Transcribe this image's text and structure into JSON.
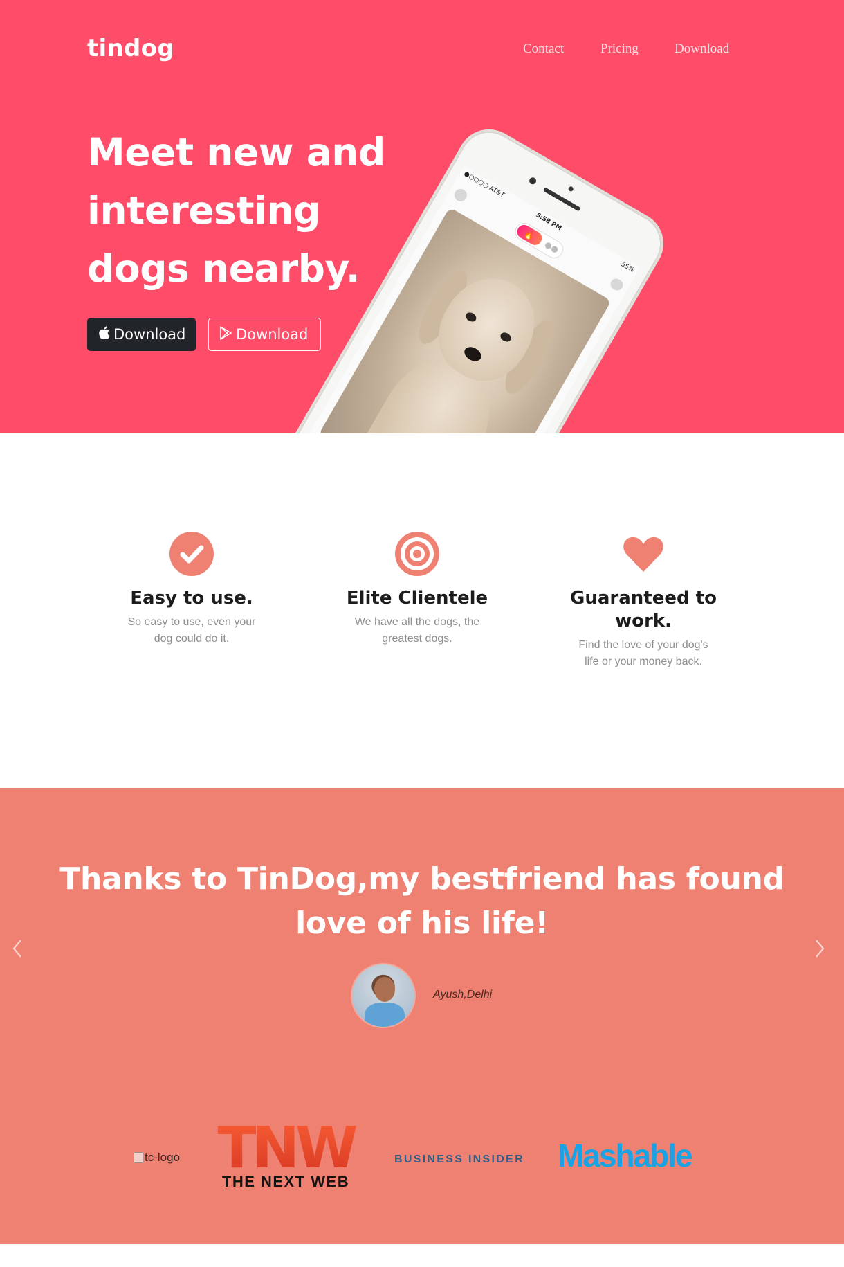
{
  "header": {
    "brand": "tindog",
    "nav": [
      {
        "label": "Contact"
      },
      {
        "label": "Pricing"
      },
      {
        "label": "Download"
      }
    ]
  },
  "hero": {
    "title": "Meet new and interesting dogs nearby.",
    "buttons": [
      {
        "label": "Download",
        "icon": "apple-icon"
      },
      {
        "label": "Download",
        "icon": "google-play-icon"
      }
    ],
    "phone": {
      "carrier": "●○○○○ AT&T",
      "time": "5:58 PM",
      "battery": "55%"
    }
  },
  "features": [
    {
      "icon": "check-circle-icon",
      "title": "Easy to use.",
      "description": "So easy to use, even your dog could do it."
    },
    {
      "icon": "bullseye-icon",
      "title": "Elite Clientele",
      "description": "We have all the dogs, the greatest dogs."
    },
    {
      "icon": "heart-icon",
      "title": "Guaranteed to work.",
      "description": "Find the love of your dog's life or your money back."
    }
  ],
  "testimonial": {
    "quote": "Thanks to TinDog,my bestfriend has found love of his life!",
    "author": "Ayush,Delhi"
  },
  "press": {
    "tc_alt": "tc-logo",
    "tnw_mark": "TNW",
    "tnw_sub": "THE NEXT WEB",
    "business_insider": "BUSINESS INSIDER",
    "mashable": "Mashable"
  },
  "colors": {
    "hero_bg": "#ff4c68",
    "accent": "#ef8172",
    "dark_button": "#212529"
  }
}
